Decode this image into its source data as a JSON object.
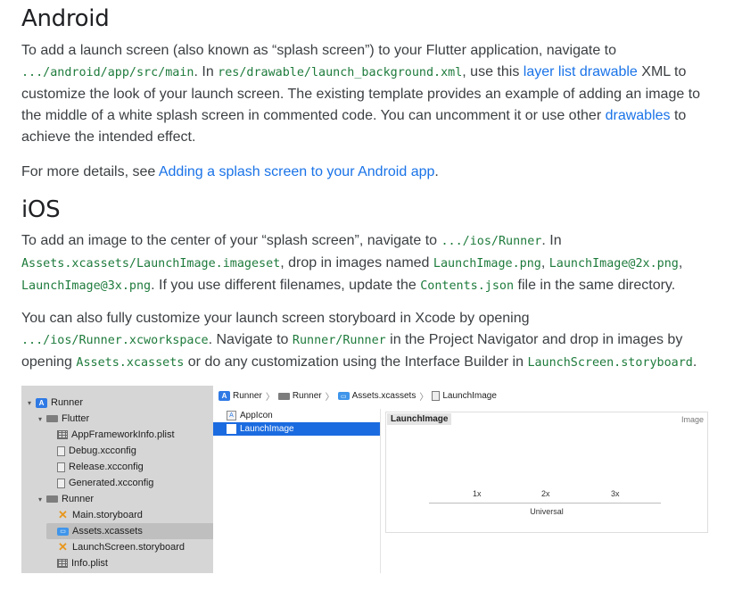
{
  "android": {
    "heading": "Android",
    "p1": {
      "t1": "To add a launch screen (also known as “splash screen”) to your Flutter application, navigate to ",
      "code1": ".../android/app/src/main",
      "t2": ". In ",
      "code2": "res/drawable/launch_background.xml",
      "t3": ", use this ",
      "link1": "layer list drawable",
      "t4": " XML to customize the look of your launch screen. The existing template provides an example of adding an image to the middle of a white splash screen in commented code. You can uncomment it or use other ",
      "link2": "drawables",
      "t5": " to achieve the intended effect."
    },
    "p2": {
      "t1": "For more details, see ",
      "link": "Adding a splash screen to your Android app",
      "t2": "."
    }
  },
  "ios": {
    "heading": "iOS",
    "p1": {
      "t1": "To add an image to the center of your “splash screen”, navigate to ",
      "code1": ".../ios/Runner",
      "t2": ". In ",
      "code2": "Assets.xcassets/LaunchImage.imageset",
      "t3": ", drop in images named ",
      "code3": "LaunchImage.png",
      "t4": ", ",
      "code4": "LaunchImage@2x.png",
      "t5": ", ",
      "code5": "LaunchImage@3x.png",
      "t6": ". If you use different filenames, update the ",
      "code6": "Contents.json",
      "t7": " file in the same directory."
    },
    "p2": {
      "t1": "You can also fully customize your launch screen storyboard in Xcode by opening ",
      "code1": ".../ios/Runner.xcworkspace",
      "t2": ". Navigate to ",
      "code2": "Runner/Runner",
      "t3": " in the Project Navigator and drop in images by opening ",
      "code3": "Assets.xcassets",
      "t4": " or do any customization using the Interface Builder in ",
      "code4": "LaunchScreen.storyboard",
      "t5": "."
    }
  },
  "xcode": {
    "tree": [
      {
        "label": "Runner",
        "icon": "project-icon",
        "depth": 0,
        "disclosure": "open"
      },
      {
        "label": "Flutter",
        "icon": "folder-icon",
        "depth": 1,
        "disclosure": "open"
      },
      {
        "label": "AppFrameworkInfo.plist",
        "icon": "plist-icon",
        "depth": 2
      },
      {
        "label": "Debug.xcconfig",
        "icon": "config-file-icon",
        "depth": 2
      },
      {
        "label": "Release.xcconfig",
        "icon": "config-file-icon",
        "depth": 2
      },
      {
        "label": "Generated.xcconfig",
        "icon": "config-file-icon",
        "depth": 2
      },
      {
        "label": "Runner",
        "icon": "folder-icon",
        "depth": 1,
        "disclosure": "open"
      },
      {
        "label": "Main.storyboard",
        "icon": "storyboard-icon",
        "depth": 2
      },
      {
        "label": "Assets.xcassets",
        "icon": "asset-catalog-icon",
        "depth": 2,
        "selected": true
      },
      {
        "label": "LaunchScreen.storyboard",
        "icon": "storyboard-icon",
        "depth": 2
      },
      {
        "label": "Info.plist",
        "icon": "plist-icon",
        "depth": 2
      }
    ],
    "breadcrumb": [
      "Runner",
      "Runner",
      "Assets.xcassets",
      "LaunchImage"
    ],
    "assets": [
      {
        "label": "AppIcon",
        "selected": false
      },
      {
        "label": "LaunchImage",
        "selected": true
      }
    ],
    "detail": {
      "title": "LaunchImage",
      "kind": "Image",
      "slots": [
        "1x",
        "2x",
        "3x"
      ],
      "idiom": "Universal"
    }
  }
}
